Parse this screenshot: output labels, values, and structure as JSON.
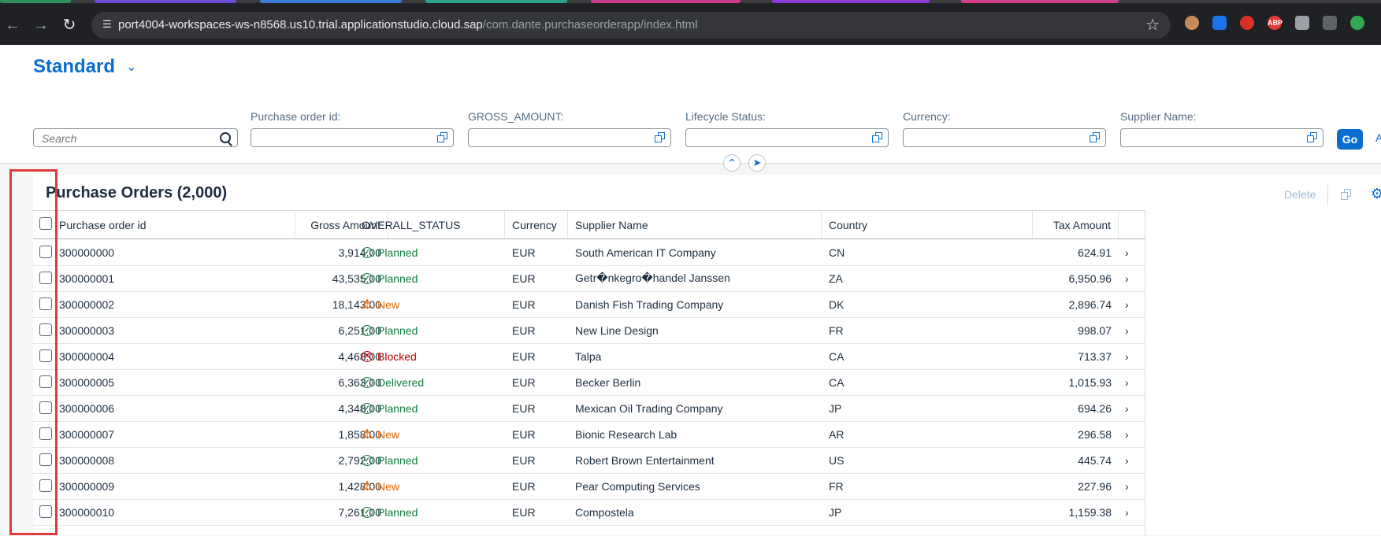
{
  "browser": {
    "url_host": "port4004-workspaces-ws-n8568.us10.trial.applicationstudio.cloud.sap",
    "url_path": "/com.dante.purchaseorderapp/index.html",
    "back_icon": "arrow-left-icon",
    "forward_icon": "arrow-right-icon",
    "reload_icon": "reload-icon",
    "bookmark_icon": "star-icon",
    "extension_abp_label": "ABP"
  },
  "header": {
    "variant_title": "Standard",
    "search_placeholder": "Search",
    "filters": [
      {
        "label": "Purchase order id:"
      },
      {
        "label": "GROSS_AMOUNT:"
      },
      {
        "label": "Lifecycle Status:"
      },
      {
        "label": "Currency:"
      },
      {
        "label": "Supplier Name:"
      }
    ],
    "go_label": "Go",
    "adapt_label": "A"
  },
  "table": {
    "title": "Purchase Orders (2,000)",
    "delete_label": "Delete",
    "columns": [
      "Purchase order id",
      "Gross Amount",
      "OVERALL_STATUS",
      "Currency",
      "Supplier Name",
      "Country",
      "Tax Amount"
    ],
    "rows": [
      {
        "id": "300000000",
        "gross": "3,914.00",
        "status": "Planned",
        "status_type": "success",
        "currency": "EUR",
        "supplier": "South American IT Company",
        "country": "CN",
        "tax": "624.91"
      },
      {
        "id": "300000001",
        "gross": "43,535.00",
        "status": "Planned",
        "status_type": "success",
        "currency": "EUR",
        "supplier": "Getr�nkegro�handel Janssen",
        "country": "ZA",
        "tax": "6,950.96"
      },
      {
        "id": "300000002",
        "gross": "18,143.00",
        "status": "New",
        "status_type": "warning",
        "currency": "EUR",
        "supplier": "Danish Fish Trading Company",
        "country": "DK",
        "tax": "2,896.74"
      },
      {
        "id": "300000003",
        "gross": "6,251.00",
        "status": "Planned",
        "status_type": "success",
        "currency": "EUR",
        "supplier": "New Line Design",
        "country": "FR",
        "tax": "998.07"
      },
      {
        "id": "300000004",
        "gross": "4,468.00",
        "status": "Blocked",
        "status_type": "error",
        "currency": "EUR",
        "supplier": "Talpa",
        "country": "CA",
        "tax": "713.37"
      },
      {
        "id": "300000005",
        "gross": "6,363.00",
        "status": "Delivered",
        "status_type": "success",
        "currency": "EUR",
        "supplier": "Becker Berlin",
        "country": "CA",
        "tax": "1,015.93"
      },
      {
        "id": "300000006",
        "gross": "4,348.00",
        "status": "Planned",
        "status_type": "success",
        "currency": "EUR",
        "supplier": "Mexican Oil Trading Company",
        "country": "JP",
        "tax": "694.26"
      },
      {
        "id": "300000007",
        "gross": "1,858.00",
        "status": "New",
        "status_type": "warning",
        "currency": "EUR",
        "supplier": "Bionic Research Lab",
        "country": "AR",
        "tax": "296.58"
      },
      {
        "id": "300000008",
        "gross": "2,792.00",
        "status": "Planned",
        "status_type": "success",
        "currency": "EUR",
        "supplier": "Robert Brown Entertainment",
        "country": "US",
        "tax": "445.74"
      },
      {
        "id": "300000009",
        "gross": "1,428.00",
        "status": "New",
        "status_type": "warning",
        "currency": "EUR",
        "supplier": "Pear Computing Services",
        "country": "FR",
        "tax": "227.96"
      },
      {
        "id": "300000010",
        "gross": "7,261.00",
        "status": "Planned",
        "status_type": "success",
        "currency": "EUR",
        "supplier": "Compostela",
        "country": "JP",
        "tax": "1,159.38"
      }
    ]
  },
  "colors": {
    "accent": "#0a6ed1",
    "success": "#107e3e",
    "warning": "#e76500",
    "error": "#bb0000",
    "highlight": "#e03a3a"
  }
}
